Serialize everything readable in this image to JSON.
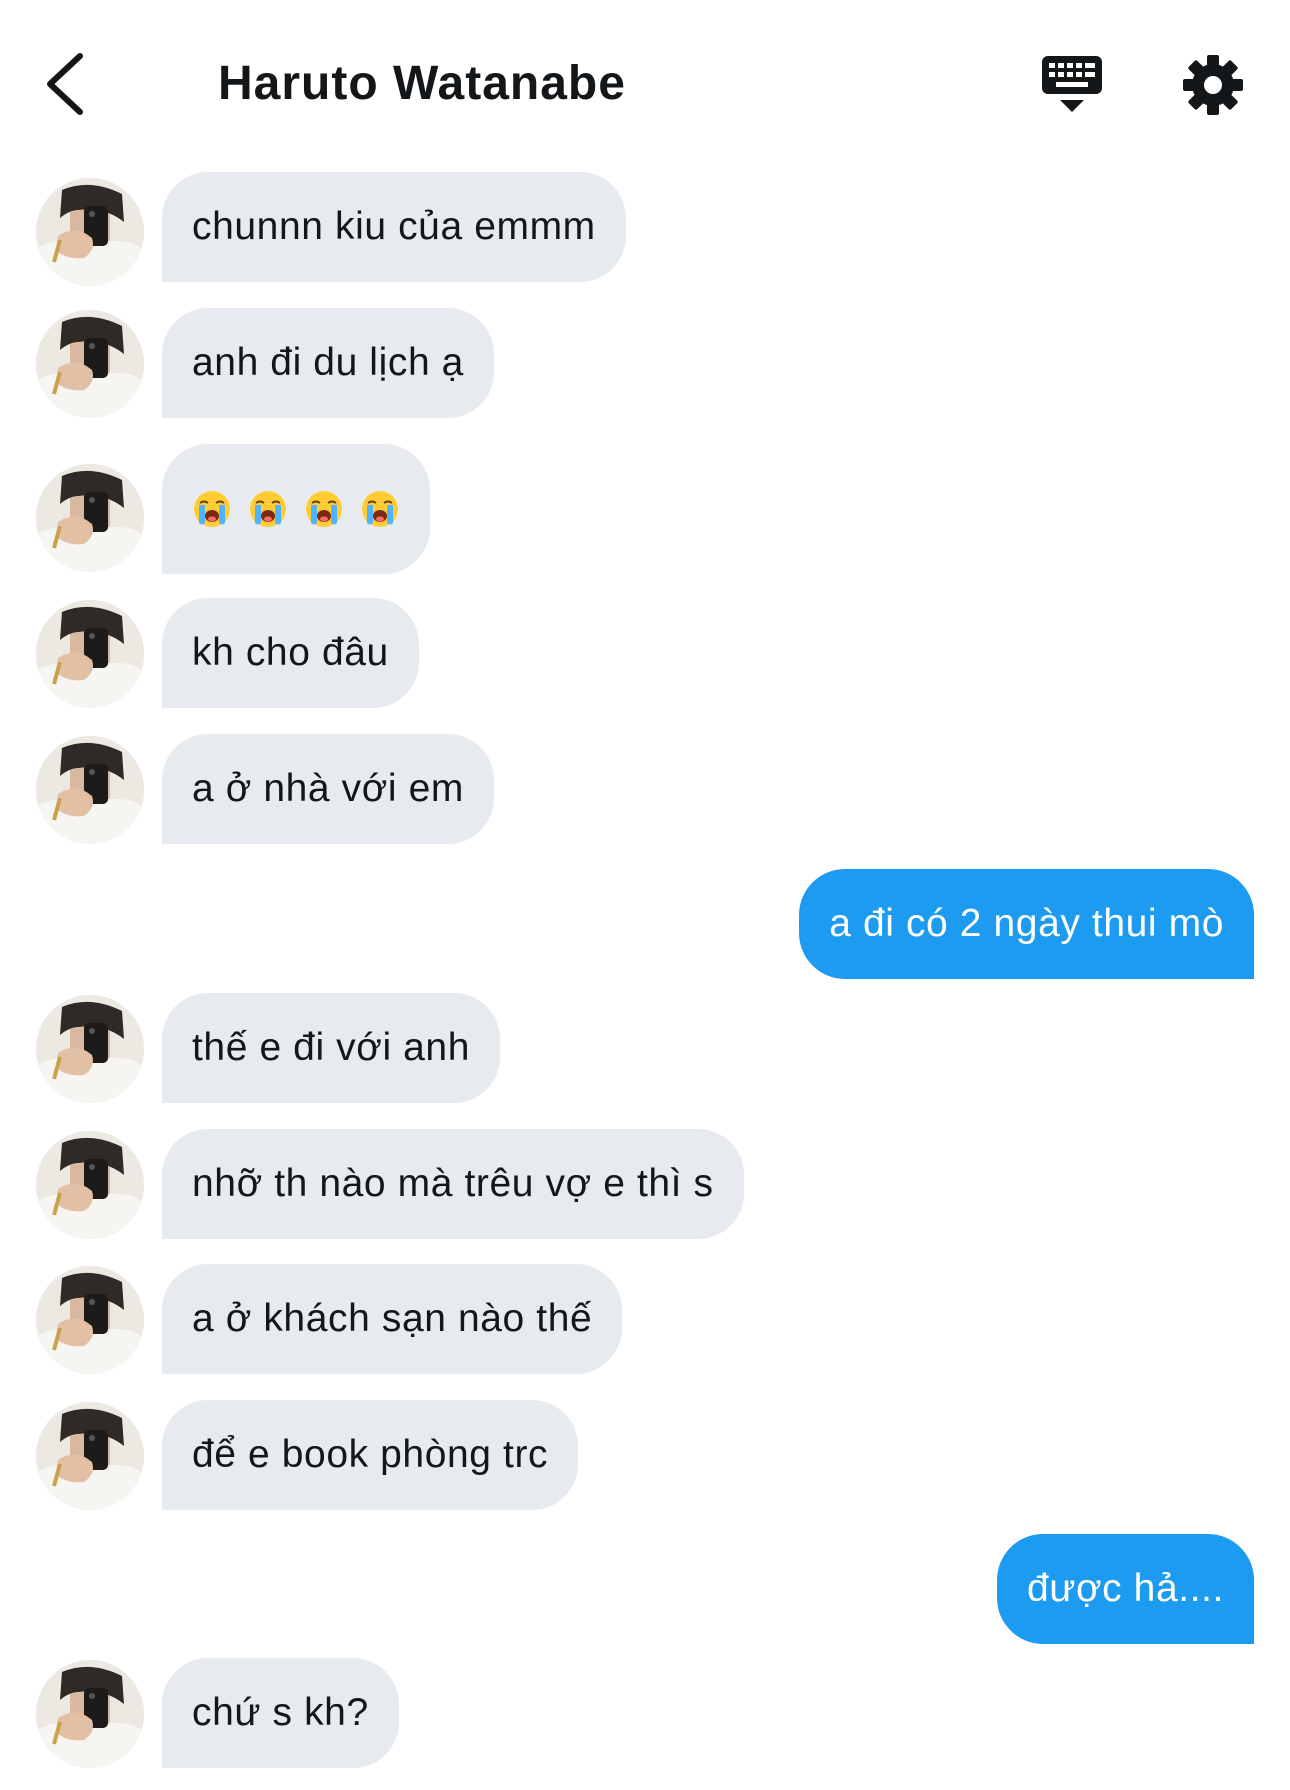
{
  "header": {
    "title": "Haruto Watanabe",
    "back_icon": "chevron-left-icon",
    "keyboard_icon": "keyboard-icon",
    "settings_icon": "gear-icon"
  },
  "colors": {
    "incoming_bubble": "#e7eaee",
    "outgoing_bubble": "#1d9bf0",
    "text": "#14171a"
  },
  "messages": [
    {
      "sender": "them",
      "text": "chunnn kiu của emmm"
    },
    {
      "sender": "them",
      "text": "anh đi du lịch ạ"
    },
    {
      "sender": "them",
      "text": "😭😭😭😭",
      "emoji": "loudly-crying-face",
      "emoji_count": 4
    },
    {
      "sender": "them",
      "text": "kh cho đâu"
    },
    {
      "sender": "them",
      "text": "a ở nhà với em"
    },
    {
      "sender": "me",
      "text": "a đi có 2 ngày thui mò"
    },
    {
      "sender": "them",
      "text": "thế e đi với anh"
    },
    {
      "sender": "them",
      "text": "nhỡ th nào mà trêu vợ e thì s"
    },
    {
      "sender": "them",
      "text": "a ở khách sạn nào thế"
    },
    {
      "sender": "them",
      "text": "để e book phòng trc"
    },
    {
      "sender": "me",
      "text": "được hả...."
    },
    {
      "sender": "them",
      "text": "chứ s kh?"
    }
  ]
}
